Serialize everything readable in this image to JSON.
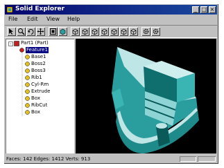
{
  "window": {
    "title": "Solid Explorer"
  },
  "menubar": {
    "items": [
      "File",
      "Edit",
      "View",
      "Help"
    ]
  },
  "tree": {
    "root_label": "Part1 (Part)",
    "selected_label": "Feature1",
    "items": [
      "Base1",
      "Boss2",
      "Boss3",
      "Rib1",
      "Cyl-Rm",
      "Extrude",
      "Box",
      "RibCut",
      "Box"
    ]
  },
  "statusbar": {
    "text": "Faces: 142  Edges: 1412  Verts: 913"
  },
  "colors": {
    "part_top": "#bfe6e6",
    "part_side": "#2a9e9e",
    "part_dark": "#0b5a5a",
    "titlebar": "#06066e"
  }
}
